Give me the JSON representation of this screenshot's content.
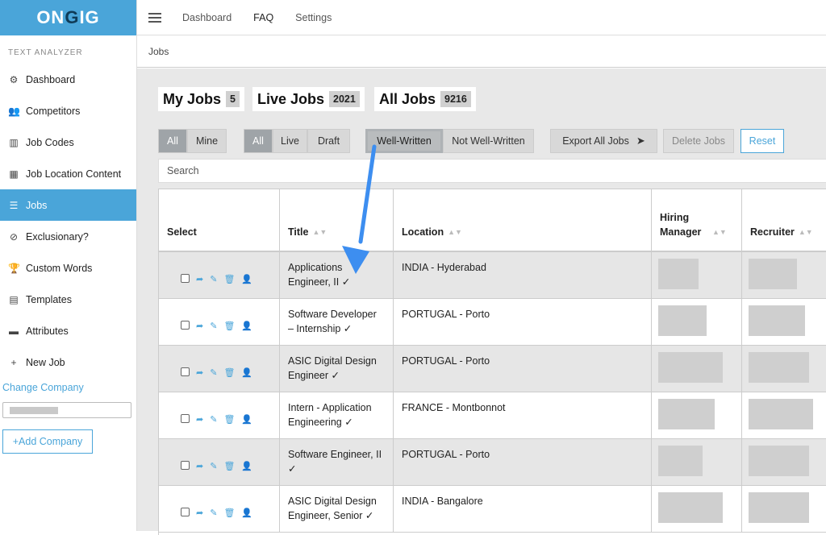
{
  "brand": {
    "logo_a": "ON",
    "logo_b": "G",
    "logo_c": "IG"
  },
  "sidebar": {
    "section_label": "TEXT ANALYZER",
    "items": [
      {
        "label": "Dashboard",
        "icon": "⚙"
      },
      {
        "label": "Competitors",
        "icon": "👥"
      },
      {
        "label": "Job Codes",
        "icon": "▥"
      },
      {
        "label": "Job Location Content",
        "icon": "▦"
      },
      {
        "label": "Jobs",
        "icon": "☰"
      },
      {
        "label": "Exclusionary?",
        "icon": "⊘"
      },
      {
        "label": "Custom Words",
        "icon": "🏆"
      },
      {
        "label": "Templates",
        "icon": "▤"
      },
      {
        "label": "Attributes",
        "icon": "▬"
      },
      {
        "label": "New Job",
        "icon": "+"
      }
    ],
    "change_company": "Change Company",
    "add_company": "+Add Company"
  },
  "topbar": {
    "links": [
      "Dashboard",
      "FAQ",
      "Settings"
    ]
  },
  "breadcrumb": "Jobs",
  "counters": [
    {
      "label": "My Jobs",
      "count": "5"
    },
    {
      "label": "Live Jobs",
      "count": "2021"
    },
    {
      "label": "All Jobs",
      "count": "9216"
    }
  ],
  "filters": {
    "owner": [
      "All",
      "Mine"
    ],
    "status": [
      "All",
      "Live",
      "Draft"
    ],
    "quality": [
      "Well-Written",
      "Not Well-Written"
    ],
    "export": "Export All Jobs",
    "delete": "Delete Jobs",
    "reset": "Reset"
  },
  "search": {
    "placeholder": "Search"
  },
  "table": {
    "headers": [
      "Select",
      "Title",
      "Location",
      "Hiring Manager",
      "Recruiter"
    ],
    "rows": [
      {
        "title": "Applications Engineer, II ✓",
        "location": "INDIA - Hyderabad"
      },
      {
        "title": "Software Developer – Internship ✓",
        "location": "PORTUGAL - Porto"
      },
      {
        "title": "ASIC Digital Design Engineer ✓",
        "location": "PORTUGAL - Porto"
      },
      {
        "title": "Intern - Application Engineering ✓",
        "location": "FRANCE - Montbonnot"
      },
      {
        "title": "Software Engineer, II ✓",
        "location": "PORTUGAL - Porto"
      },
      {
        "title": "ASIC Digital Design Engineer, Senior ✓",
        "location": "INDIA - Bangalore"
      }
    ]
  },
  "colors": {
    "accent": "#4aa5d9",
    "arrow": "#3d8ef0"
  }
}
